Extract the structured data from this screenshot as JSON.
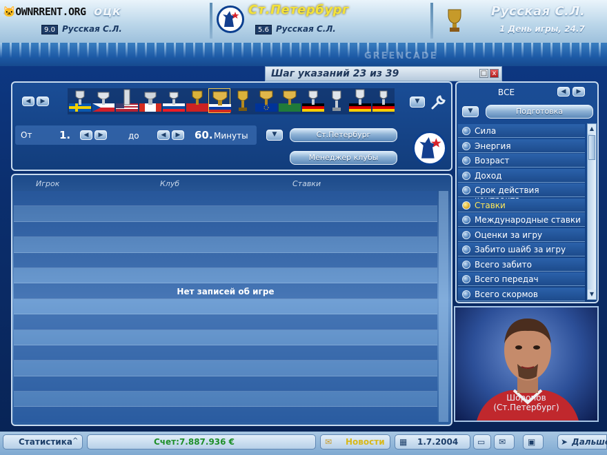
{
  "header": {
    "watermark": "OWNRRENT.ORG",
    "left_team": {
      "name_fragment": "оцк",
      "rating": "9.0",
      "league": "Русская С.Л."
    },
    "center_team": {
      "name": "Ст.Петербург",
      "rating": "5.6",
      "league": "Русская С.Л."
    },
    "right_info": {
      "league": "Русская С.Л.",
      "day": "1 День игры, 24.7"
    },
    "brand": "GREENCADE"
  },
  "step_window": {
    "title": "Шаг указаний 23 из 39",
    "buttons": [
      "□",
      "x"
    ]
  },
  "filter": {
    "from_label": "От",
    "from_value": "1.",
    "to_label": "до",
    "to_value": "60.",
    "minutes_label": "Минуты",
    "team_select": "Ст.Петербург",
    "manager_button": "Менеджер клубы"
  },
  "category_panel": {
    "all_label": "ВСЕ",
    "dropdown_label": "Подготовка"
  },
  "table": {
    "columns": [
      "Игрок",
      "Клуб",
      "Ставки"
    ],
    "empty_message": "Нет записей об игре",
    "row_count": 15
  },
  "stats_list": {
    "items": [
      "Сила",
      "Энергия",
      "Возраст",
      "Доход",
      "Срок действия контракта",
      "Ставки",
      "Международные ставки",
      "Оценки за игру",
      "Забито шайб за игру",
      "Всего забито",
      "Всего передач",
      "Всего скормов"
    ],
    "selected_index": 5
  },
  "player": {
    "name": "Шоропов",
    "club": "(Ст.Петербург)"
  },
  "bottom": {
    "stats": "Статистика",
    "balance": "Счет:7.887.936 €",
    "news": "Новости",
    "date": "1.7.2004",
    "next": "Дальше"
  },
  "colors": {
    "background": "#0e3c8c",
    "panel": "#1a4d96",
    "highlight": "#ffe95a",
    "balance_text": "#1e8f2a",
    "team_title": "#f4e23a"
  }
}
